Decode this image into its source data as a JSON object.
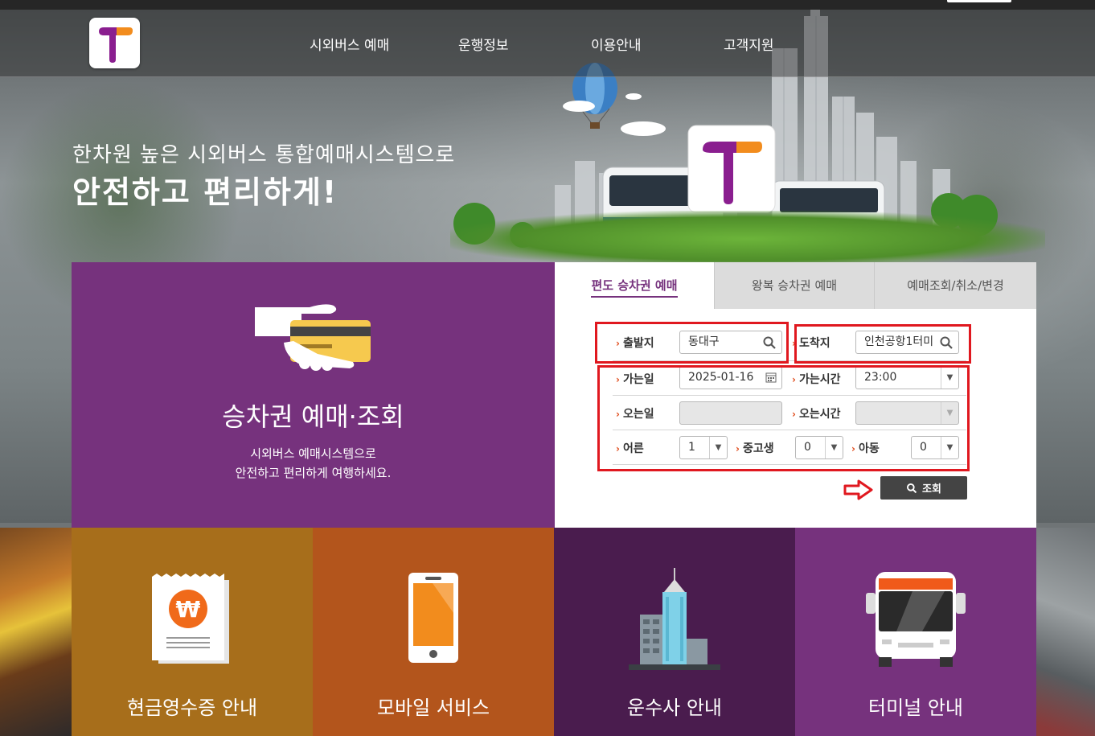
{
  "colors": {
    "brand_purple": "#76327d",
    "brand_orange": "#f28c1d",
    "tile_cash": "#a76e1b",
    "tile_mobile": "#b3551c",
    "tile_carrier": "#4a1c4e",
    "tile_terminal": "#76327d",
    "highlight_red": "#e0181f"
  },
  "nav": {
    "items": [
      {
        "label": "시외버스 예매"
      },
      {
        "label": "운행정보"
      },
      {
        "label": "이용안내"
      },
      {
        "label": "고객지원"
      }
    ]
  },
  "hero": {
    "line1": "한차원 높은 시외버스 통합예매시스템으로",
    "line2": "안전하고 편리하게!"
  },
  "booking_intro": {
    "title": "승차권 예매·조회",
    "sub1": "시외버스 예매시스템으로",
    "sub2": "안전하고 편리하게 여행하세요."
  },
  "tabs": [
    {
      "label": "편도 승차권 예매",
      "active": true
    },
    {
      "label": "왕복 승차권 예매",
      "active": false
    },
    {
      "label": "예매조회/취소/변경",
      "active": false
    }
  ],
  "form": {
    "departure": {
      "label": "출발지",
      "value": "동대구"
    },
    "arrival": {
      "label": "도착지",
      "value": "인천공항1터미"
    },
    "go_date": {
      "label": "가는일",
      "value": "2025-01-16"
    },
    "go_time": {
      "label": "가는시간",
      "value": "23:00"
    },
    "return_date": {
      "label": "오는일",
      "value": ""
    },
    "return_time": {
      "label": "오는시간",
      "value": ""
    },
    "adult": {
      "label": "어른",
      "value": "1"
    },
    "student": {
      "label": "중고생",
      "value": "0"
    },
    "child": {
      "label": "아동",
      "value": "0"
    },
    "search_button": "조회"
  },
  "tiles": [
    {
      "label": "현금영수증 안내",
      "icon": "receipt-won-icon"
    },
    {
      "label": "모바일 서비스",
      "icon": "smartphone-icon"
    },
    {
      "label": "운수사 안내",
      "icon": "building-icon"
    },
    {
      "label": "터미널 안내",
      "icon": "bus-front-icon"
    }
  ]
}
